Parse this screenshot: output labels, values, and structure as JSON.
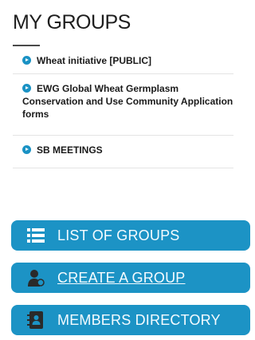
{
  "header": {
    "title": "MY GROUPS"
  },
  "groups": [
    {
      "label": "Wheat initiative [PUBLIC]"
    },
    {
      "label": "EWG Global Wheat Germplasm Conservation and Use Community Application forms"
    },
    {
      "label": "SB MEETINGS"
    }
  ],
  "actions": {
    "list_groups": "LIST OF GROUPS",
    "create_group": "CREATE A GROUP",
    "members_directory": "MEMBERS DIRECTORY"
  },
  "icons": {
    "bullet": "play-circle-icon",
    "list": "list-icon",
    "create": "user-add-icon",
    "directory": "address-book-icon"
  },
  "colors": {
    "accent": "#1c93c5"
  }
}
